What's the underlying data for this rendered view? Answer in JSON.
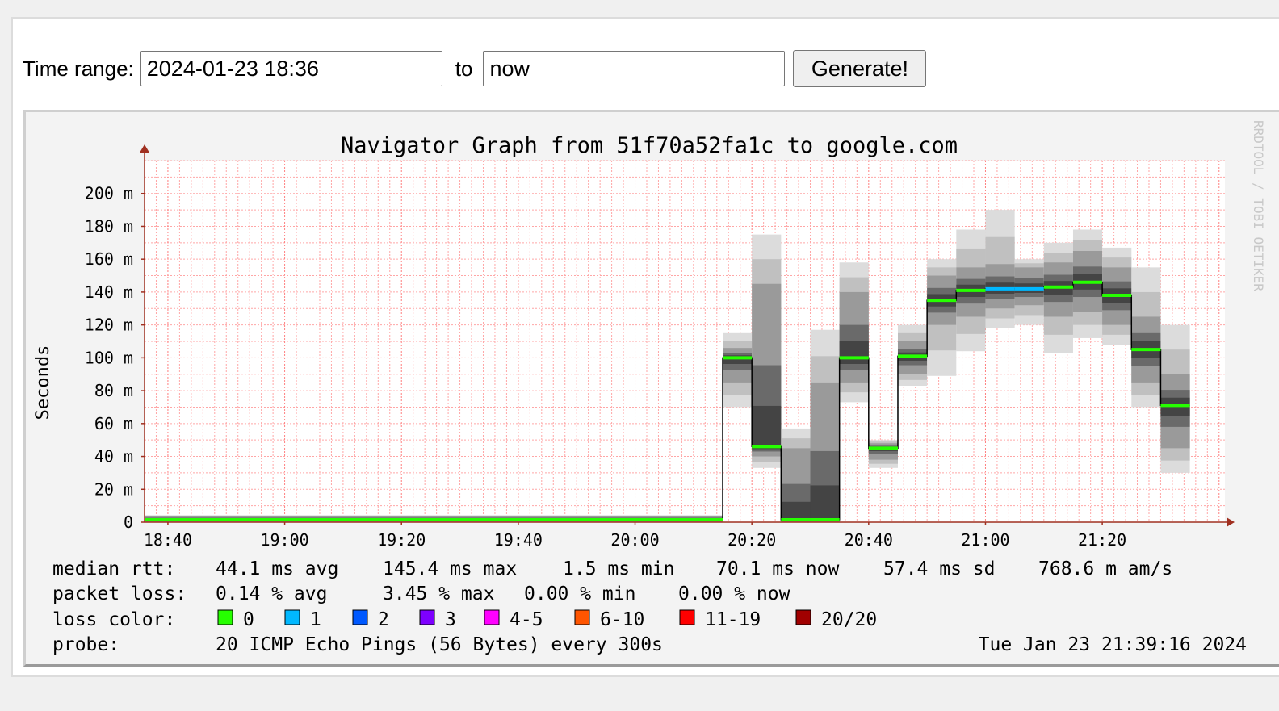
{
  "form": {
    "time_range_label": "Time range:",
    "from_value": "2024-01-23 18:36",
    "to_label": "to",
    "to_value": "now",
    "generate_label": "Generate!"
  },
  "chart_data": {
    "type": "area",
    "title": "Navigator Graph from 51f70a52fa1c to google.com",
    "ylabel": "Seconds",
    "watermark": "RRDTOOL / TOBI OETIKER",
    "ylim": [
      0,
      0.22
    ],
    "y_ticks": [
      {
        "value": 0,
        "label": "0"
      },
      {
        "value": 0.02,
        "label": "20 m"
      },
      {
        "value": 0.04,
        "label": "40 m"
      },
      {
        "value": 0.06,
        "label": "60 m"
      },
      {
        "value": 0.08,
        "label": "80 m"
      },
      {
        "value": 0.1,
        "label": "100 m"
      },
      {
        "value": 0.12,
        "label": "120 m"
      },
      {
        "value": 0.14,
        "label": "140 m"
      },
      {
        "value": 0.16,
        "label": "160 m"
      },
      {
        "value": 0.18,
        "label": "180 m"
      },
      {
        "value": 0.2,
        "label": "200 m"
      }
    ],
    "x_range": [
      "18:36",
      "21:41"
    ],
    "x_ticks": [
      "18:40",
      "19:00",
      "19:20",
      "19:40",
      "20:00",
      "20:20",
      "20:40",
      "21:00",
      "21:20"
    ],
    "median_series": [
      {
        "start": "18:36",
        "end": "20:15",
        "median": 0.0015,
        "loss": "0",
        "smoke": [
          0.0,
          0.004,
          0.0,
          0.004
        ]
      },
      {
        "start": "20:15",
        "end": "20:20",
        "median": 0.1,
        "loss": "0",
        "smoke": [
          0.07,
          0.115,
          0.085,
          0.106
        ]
      },
      {
        "start": "20:20",
        "end": "20:25",
        "median": 0.046,
        "loss": "0",
        "smoke": [
          0.033,
          0.175,
          0.04,
          0.145
        ]
      },
      {
        "start": "20:25",
        "end": "20:30",
        "median": 0.0015,
        "loss": "0",
        "smoke": [
          0.0,
          0.057,
          0.0,
          0.045
        ]
      },
      {
        "start": "20:30",
        "end": "20:35",
        "median": 0.0015,
        "loss": "0",
        "smoke": [
          0.0,
          0.117,
          0.0,
          0.085
        ]
      },
      {
        "start": "20:35",
        "end": "20:40",
        "median": 0.1,
        "loss": "0",
        "smoke": [
          0.073,
          0.158,
          0.085,
          0.14
        ]
      },
      {
        "start": "20:40",
        "end": "20:45",
        "median": 0.045,
        "loss": "0",
        "smoke": [
          0.033,
          0.05,
          0.038,
          0.048
        ]
      },
      {
        "start": "20:45",
        "end": "20:50",
        "median": 0.101,
        "loss": "0",
        "smoke": [
          0.083,
          0.12,
          0.09,
          0.11
        ]
      },
      {
        "start": "20:50",
        "end": "20:55",
        "median": 0.135,
        "loss": "0",
        "smoke": [
          0.089,
          0.16,
          0.12,
          0.15
        ]
      },
      {
        "start": "20:55",
        "end": "21:00",
        "median": 0.141,
        "loss": "0",
        "smoke": [
          0.104,
          0.178,
          0.125,
          0.155
        ]
      },
      {
        "start": "21:00",
        "end": "21:05",
        "median": 0.142,
        "loss": "1",
        "smoke": [
          0.118,
          0.19,
          0.13,
          0.157
        ]
      },
      {
        "start": "21:05",
        "end": "21:10",
        "median": 0.142,
        "loss": "1",
        "smoke": [
          0.12,
          0.16,
          0.132,
          0.155
        ]
      },
      {
        "start": "21:10",
        "end": "21:15",
        "median": 0.143,
        "loss": "0",
        "smoke": [
          0.103,
          0.17,
          0.125,
          0.158
        ]
      },
      {
        "start": "21:15",
        "end": "21:20",
        "median": 0.146,
        "loss": "0",
        "smoke": [
          0.112,
          0.178,
          0.128,
          0.165
        ]
      },
      {
        "start": "21:20",
        "end": "21:25",
        "median": 0.138,
        "loss": "0",
        "smoke": [
          0.108,
          0.167,
          0.12,
          0.155
        ]
      },
      {
        "start": "21:25",
        "end": "21:30",
        "median": 0.105,
        "loss": "0",
        "smoke": [
          0.07,
          0.155,
          0.085,
          0.125
        ]
      },
      {
        "start": "21:30",
        "end": "21:35",
        "median": 0.071,
        "loss": "0",
        "smoke": [
          0.03,
          0.12,
          0.045,
          0.09
        ]
      }
    ],
    "stats": {
      "rtt_label": "median rtt:",
      "rtt_avg": "44.1 ms avg",
      "rtt_max": "145.4 ms max",
      "rtt_min": "1.5 ms min",
      "rtt_now": "70.1 ms now",
      "rtt_sd": "57.4 ms sd",
      "rtt_ams": "768.6 m am/s",
      "loss_label": "packet loss:",
      "loss_avg": "0.14 % avg",
      "loss_max": "3.45 % max",
      "loss_min": "0.00 % min",
      "loss_now": "0.00 % now",
      "loss_color_label": "loss color:",
      "probe_label": "probe:",
      "probe_text": "20 ICMP Echo Pings (56 Bytes) every 300s",
      "timestamp": "Tue Jan 23 21:39:16 2024"
    },
    "loss_legend": [
      {
        "label": "0",
        "color": "#26ff00"
      },
      {
        "label": "1",
        "color": "#00b8ff"
      },
      {
        "label": "2",
        "color": "#0059ff"
      },
      {
        "label": "3",
        "color": "#7e00ff"
      },
      {
        "label": "4-5",
        "color": "#ff00ff"
      },
      {
        "label": "6-10",
        "color": "#ff5500"
      },
      {
        "label": "11-19",
        "color": "#ff0000"
      },
      {
        "label": "20/20",
        "color": "#a10000"
      }
    ],
    "colors": {
      "grid_minor": "#ffa6a6",
      "grid_major": "#ff8080",
      "axis": "#a03020",
      "median_line": "#000000"
    }
  }
}
